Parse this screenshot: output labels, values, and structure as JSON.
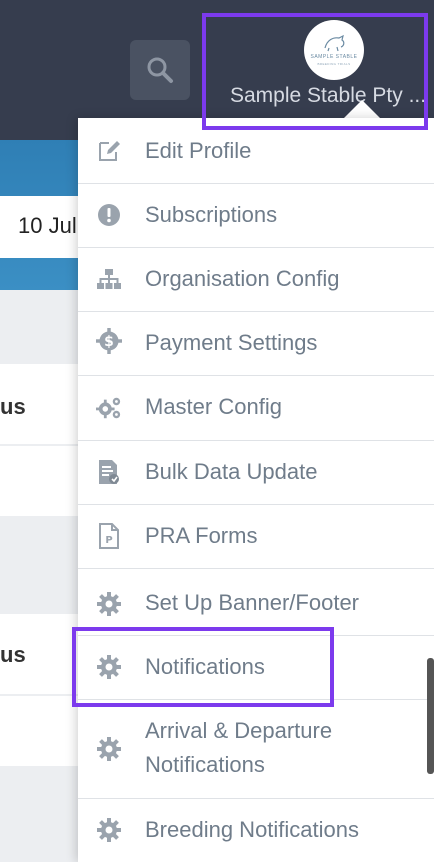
{
  "header": {
    "company_name": "Sample Stable Pty ...",
    "logo_text": "SAMPLE STABLE",
    "logo_subtext": "BREEDING TRIALS"
  },
  "background": {
    "date_value": "10 Jul",
    "status_fragments": [
      "us",
      "us"
    ]
  },
  "menu": {
    "items": [
      {
        "label": "Edit Profile",
        "icon": "edit-icon"
      },
      {
        "label": "Subscriptions",
        "icon": "alert-circle-icon"
      },
      {
        "label": "Organisation Config",
        "icon": "org-chart-icon"
      },
      {
        "label": "Payment Settings",
        "icon": "dollar-gear-icon"
      },
      {
        "label": "Master Config",
        "icon": "gears-icon"
      },
      {
        "label": "Bulk Data Update",
        "icon": "document-icon"
      },
      {
        "label": "PRA Forms",
        "icon": "pdf-file-icon"
      },
      {
        "label": "Set Up Banner/Footer",
        "icon": "gear-icon"
      },
      {
        "label": "Notifications",
        "icon": "gear-icon"
      },
      {
        "label": "Arrival & Departure Notifications",
        "icon": "gear-icon"
      },
      {
        "label": "Breeding Notifications",
        "icon": "gear-icon"
      }
    ]
  },
  "colors": {
    "topbar": "#363d4e",
    "accent_highlight": "#7c3aed",
    "menu_text": "#6f7c8a",
    "icon_gray": "#9aa3ad"
  }
}
